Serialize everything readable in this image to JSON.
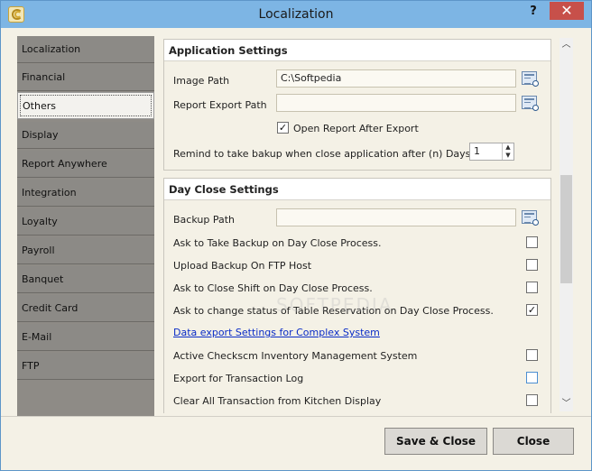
{
  "window": {
    "title": "Localization",
    "help_label": "?",
    "close_label": "✕"
  },
  "nav": {
    "items": [
      {
        "label": "Localization"
      },
      {
        "label": "Financial"
      },
      {
        "label": "Others",
        "active": true
      },
      {
        "label": "Display"
      },
      {
        "label": "Report Anywhere"
      },
      {
        "label": "Integration"
      },
      {
        "label": "Loyalty"
      },
      {
        "label": "Payroll"
      },
      {
        "label": "Banquet"
      },
      {
        "label": "Credit Card"
      },
      {
        "label": "E-Mail"
      },
      {
        "label": "FTP"
      }
    ]
  },
  "app_settings": {
    "header": "Application Settings",
    "image_path_label": "Image Path",
    "image_path_value": "C:\\Softpedia",
    "report_export_label": "Report Export Path",
    "report_export_value": "",
    "open_report_label": "Open Report After Export",
    "open_report_checked": true,
    "remind_label": "Remind to take bakup when close application after (n) Days.",
    "remind_value": "1"
  },
  "day_close": {
    "header": "Day Close Settings",
    "backup_path_label": "Backup Path",
    "backup_path_value": "",
    "options": [
      {
        "label": "Ask to Take Backup on Day Close Process.",
        "checked": false
      },
      {
        "label": "Upload Backup On FTP Host",
        "checked": false
      },
      {
        "label": "Ask to Close Shift on Day Close Process.",
        "checked": false
      },
      {
        "label": "Ask to change status of Table Reservation on Day Close Process.",
        "checked": true
      }
    ],
    "export_link": "Data export Settings for Complex System",
    "more_options": [
      {
        "label": "Active Checkscm Inventory Management System",
        "checked": false
      },
      {
        "label": "Export for Transaction Log",
        "checked": false
      },
      {
        "label": "Clear All Transaction from Kitchen Display",
        "checked": false
      }
    ]
  },
  "footer": {
    "save_label": "Save & Close",
    "close_label": "Close"
  },
  "watermark": "SOFTPEDIA",
  "colors": {
    "titlebar": "#7db5e4",
    "nav": "#8c8a86",
    "link": "#0a2cc7",
    "close": "#c7504a"
  }
}
